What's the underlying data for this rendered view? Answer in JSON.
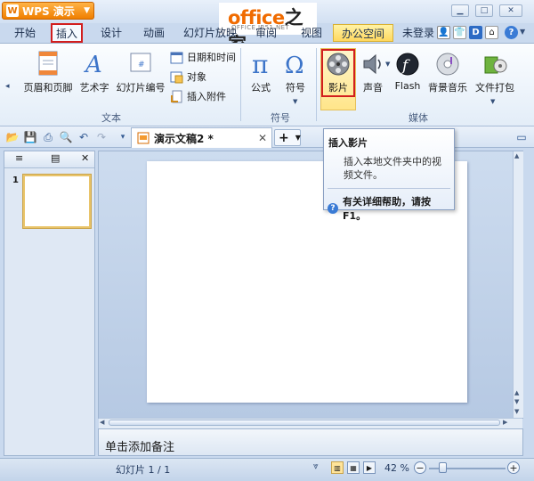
{
  "titlebar": {
    "app_name": "WPS 演示",
    "app_logo": "W",
    "watermark_main_a": "office",
    "watermark_main_b": "之家",
    "watermark_sub": "OFFICE.JB51.NET"
  },
  "tabs": {
    "start": "开始",
    "insert": "插入",
    "design": "设计",
    "animation": "动画",
    "slideshow": "幻灯片放映",
    "review": "审阅",
    "view": "视图",
    "office_space": "办公空间",
    "login": "未登录"
  },
  "ribbon": {
    "text_group": {
      "label": "文本",
      "header_footer": "页眉和页脚",
      "wordart": "艺术字",
      "slide_number": "幻灯片编号",
      "date_time": "日期和时间",
      "object": "对象",
      "attachment": "插入附件"
    },
    "symbol_group": {
      "label": "符号",
      "formula": "公式",
      "symbol": "符号"
    },
    "media_group": {
      "label": "媒体",
      "movie": "影片",
      "sound": "声音",
      "flash": "Flash",
      "bg_music": "背景音乐",
      "package": "文件打包"
    }
  },
  "doc_tab": {
    "title": "演示文稿2 *"
  },
  "tooltip": {
    "title": "插入影片",
    "description": "插入本地文件夹中的视频文件。",
    "help": "有关详细帮助，请按F1。"
  },
  "thumbnail": {
    "number": "1"
  },
  "notes": {
    "placeholder": "单击添加备注"
  },
  "status": {
    "slide_count": "幻灯片 1 / 1",
    "zoom": "42 %"
  }
}
